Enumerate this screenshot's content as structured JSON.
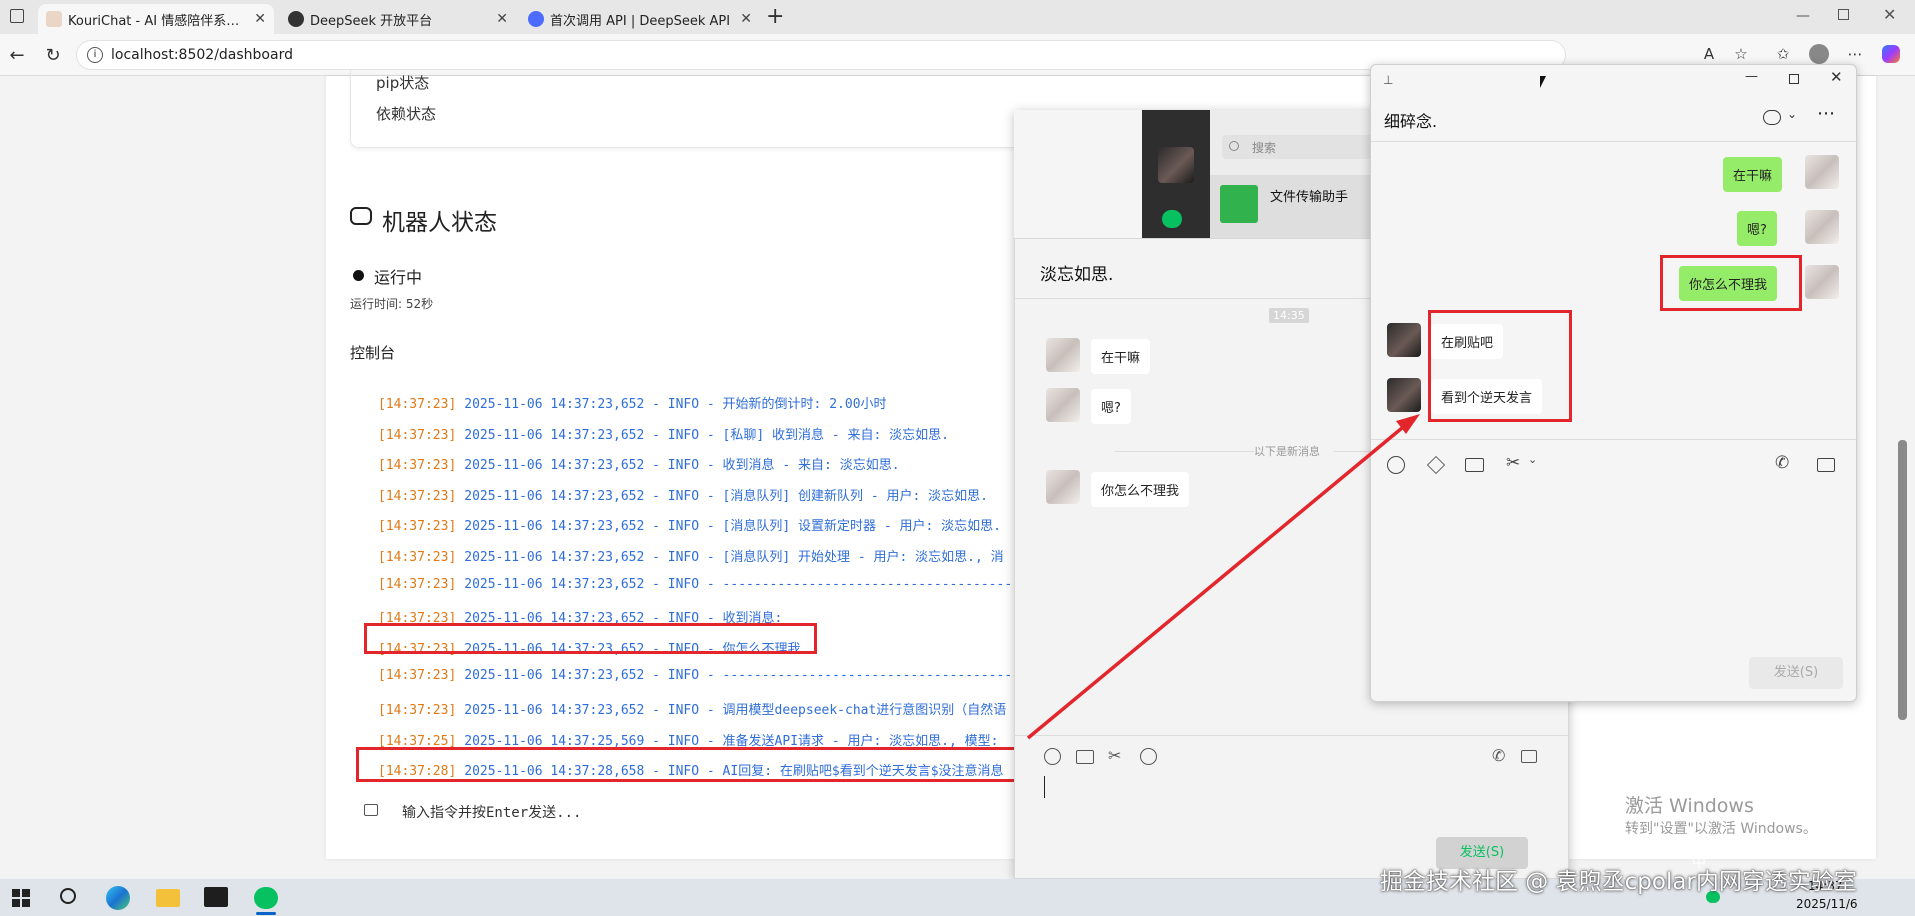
{
  "browser": {
    "tabs": [
      {
        "title": "KouriChat - AI 情感陪伴系统控制台"
      },
      {
        "title": "DeepSeek 开放平台"
      },
      {
        "title": "首次调用 API | DeepSeek API Docs"
      }
    ],
    "url": "localhost:8502/dashboard"
  },
  "dashboard": {
    "pip_status": "pip状态",
    "dep_status": "依赖状态",
    "bot_title": "机器人状态",
    "wechat_btn": "微",
    "running": "运行中",
    "uptime": "运行时间: 52秒",
    "console_title": "控制台",
    "log_lines": [
      {
        "ts": "[14:37:23]",
        "msg": "2025-11-06 14:37:23,652 - INFO - 开始新的倒计时: 2.00小时"
      },
      {
        "ts": "[14:37:23]",
        "msg": "2025-11-06 14:37:23,652 - INFO - [私聊] 收到消息 - 来自: 淡忘如思."
      },
      {
        "ts": "[14:37:23]",
        "msg": "2025-11-06 14:37:23,652 - INFO - 收到消息 - 来自: 淡忘如思."
      },
      {
        "ts": "[14:37:23]",
        "msg": "2025-11-06 14:37:23,652 - INFO - [消息队列] 创建新队列 - 用户: 淡忘如思."
      },
      {
        "ts": "[14:37:23]",
        "msg": "2025-11-06 14:37:23,652 - INFO - [消息队列] 设置新定时器 - 用户: 淡忘如思."
      },
      {
        "ts": "[14:37:23]",
        "msg": "2025-11-06 14:37:23,652 - INFO - [消息队列] 开始处理 - 用户: 淡忘如思., 消"
      },
      {
        "ts": "[14:37:23]",
        "msg": "2025-11-06 14:37:23,652 - INFO - -----------------------------------------"
      },
      {
        "ts": "[14:37:23]",
        "msg": "2025-11-06 14:37:23,652 - INFO - 收到消息:"
      },
      {
        "ts": "[14:37:23]",
        "msg": "2025-11-06 14:37:23,652 - INFO - 你怎么不理我"
      },
      {
        "ts": "[14:37:23]",
        "msg": "2025-11-06 14:37:23,652 - INFO - -----------------------------------------"
      },
      {
        "ts": "[14:37:23]",
        "msg": "2025-11-06 14:37:23,652 - INFO - 调用模型deepseek-chat进行意图识别（自然语"
      },
      {
        "ts": "[14:37:25]",
        "msg": "2025-11-06 14:37:25,569 - INFO - 准备发送API请求 - 用户: 淡忘如思., 模型:"
      },
      {
        "ts": "[14:37:28]",
        "msg": "2025-11-06 14:37:28,658 - INFO - AI回复: 在刷贴吧$看到个逆天发言$没注意消息"
      }
    ],
    "cmd_placeholder": "输入指令并按Enter发送...",
    "activate_title": "激活 Windows",
    "activate_sub": "转到\"设置\"以激活 Windows。"
  },
  "wechat_main": {
    "search_placeholder": "搜索",
    "contact_name": "文件传输助手",
    "chat_title": "淡忘如思.",
    "time_sep": "14:35",
    "new_msg_sep": "以下是新消息",
    "messages": [
      "在干嘛",
      "嗯?",
      "你怎么不理我"
    ],
    "send_label": "发送(S)"
  },
  "wechat_popup": {
    "title": "细碎念.",
    "sent": [
      "在干嘛",
      "嗯?",
      "你怎么不理我"
    ],
    "received": [
      "在刷贴吧",
      "看到个逆天发言"
    ],
    "send_label": "发送(S)"
  },
  "watermark": "掘金技术社区 @ 袁煦丞cpolar内网穿透实验室",
  "clock": {
    "time": "14:37",
    "date": "2025/11/6",
    "ime": "中"
  },
  "colors": {
    "accent_red": "#e3262c",
    "wechat_green": "#07c160",
    "bubble_green": "#95ec69"
  }
}
